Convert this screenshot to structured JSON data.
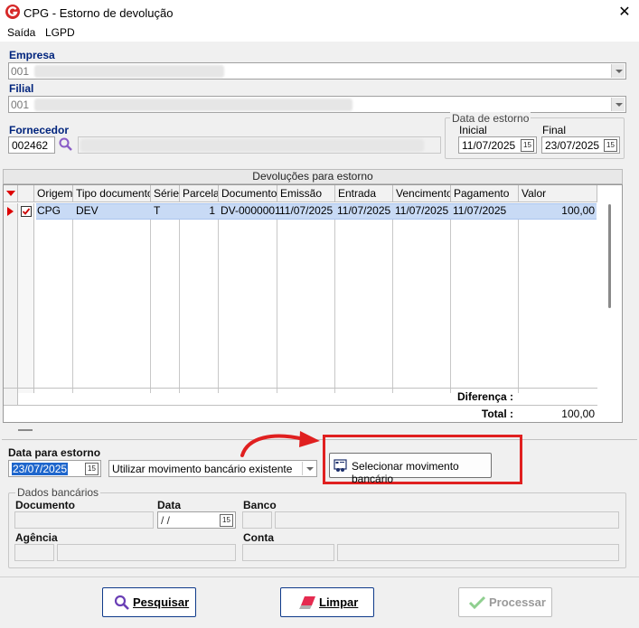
{
  "window": {
    "title": "CPG - Estorno de devolução",
    "close_label": "✕"
  },
  "menu": {
    "items": [
      "Saída",
      "LGPD"
    ]
  },
  "empresa": {
    "label": "Empresa",
    "value": "001"
  },
  "filial": {
    "label": "Filial",
    "value": "001"
  },
  "fornecedor": {
    "label": "Fornecedor",
    "code": "002462"
  },
  "data_estorno": {
    "group_title": "Data de estorno",
    "inicial_label": "Inicial",
    "inicial_value": "11/07/2025",
    "final_label": "Final",
    "final_value": "23/07/2025"
  },
  "grid": {
    "title": "Devoluções para estorno",
    "columns": [
      "Origem",
      "Tipo documento",
      "Série",
      "Parcela",
      "Documento",
      "Emissão",
      "Entrada",
      "Vencimento",
      "Pagamento",
      "Valor"
    ],
    "rows": [
      {
        "origem": "CPG",
        "tipo_documento": "DEV",
        "serie": "T",
        "parcela": "1",
        "documento": "DV-0000001",
        "emissao": "11/07/2025",
        "entrada": "11/07/2025",
        "vencimento": "11/07/2025",
        "pagamento": "11/07/2025",
        "valor": "100,00"
      }
    ],
    "diferenca_label": "Diferença :",
    "diferenca_value": "",
    "total_label": "Total :",
    "total_value": "100,00"
  },
  "estorno": {
    "data_label": "Data para estorno",
    "data_value": "23/07/2025",
    "movimento_option": "Utilizar movimento bancário existente",
    "selecionar_button": "Selecionar movimento bancário"
  },
  "dados_bancarios": {
    "group_title": "Dados bancários",
    "documento_label": "Documento",
    "data_label": "Data",
    "data_value": " / /",
    "banco_label": "Banco",
    "agencia_label": "Agência",
    "conta_label": "Conta"
  },
  "buttons": {
    "pesquisar": "Pesquisar",
    "limpar": "Limpar",
    "processar": "Processar"
  },
  "colors": {
    "accent": "#00247d",
    "highlight": "#e02020",
    "selected_row": "#c8daf5"
  }
}
